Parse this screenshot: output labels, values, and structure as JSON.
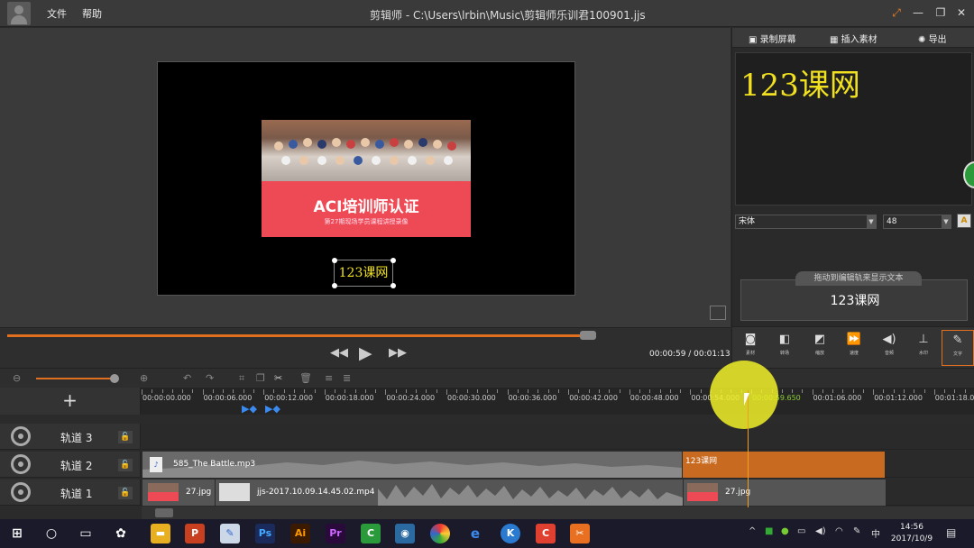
{
  "titlebar": {
    "menu": [
      "文件",
      "帮助"
    ],
    "title": "剪辑师 - C:\\Users\\lrbin\\Music\\剪辑师乐训君100901.jjs"
  },
  "preview": {
    "banner_title": "ACI培训师认证",
    "banner_sub": "第27期现场学员课程讲授录像",
    "overlay_text": "123课网"
  },
  "playback": {
    "progress": 0.99,
    "time": "00:00:59 / 00:01:13"
  },
  "right_panel": {
    "tabs": [
      "录制屏幕",
      "插入素材",
      "导出"
    ],
    "text_preview": "123课网",
    "font": "宋体",
    "size": "48",
    "color_btn": "A",
    "drag_hint": "拖动到编辑轨来显示文本",
    "drag_text": "123课网",
    "tools": [
      {
        "icon": "camera-icon",
        "label": "素材"
      },
      {
        "icon": "transition-icon",
        "label": "转场"
      },
      {
        "icon": "zoom-icon",
        "label": "缩放"
      },
      {
        "icon": "speed-icon",
        "label": "速度"
      },
      {
        "icon": "audio-icon",
        "label": "音频"
      },
      {
        "icon": "watermark-icon",
        "label": "水印"
      },
      {
        "icon": "pen-icon",
        "label": "文字"
      }
    ]
  },
  "timeline": {
    "add_label": "+",
    "ticks": [
      "00:00:00.000",
      "00:00:06.000",
      "00:00:12.000",
      "00:00:18.000",
      "00:00:24.000",
      "00:00:30.000",
      "00:00:36.000",
      "00:00:42.000",
      "00:00:48.000",
      "00:00:54.000",
      "00:00:59.650",
      "00:01:06.000",
      "00:01:12.000",
      "00:01:18.000"
    ],
    "tracks": [
      {
        "label": "轨道 3",
        "lock": "🔓"
      },
      {
        "label": "轨道 2",
        "lock": "🔓"
      },
      {
        "label": "轨道 1",
        "lock": "🔓"
      }
    ],
    "clips": {
      "audio": "585_The Battle.mp3",
      "text": "123课网",
      "img1": "27.jpg",
      "video": "jjs-2017.10.09.14.45.02.mp4",
      "img2": "27.jpg"
    }
  },
  "taskbar": {
    "icons": [
      "start-icon",
      "cortana-icon",
      "taskview-icon",
      "pinwheel-icon",
      "explorer-icon",
      "powerpoint-icon",
      "paint-icon",
      "photoshop-icon",
      "illustrator-icon",
      "premiere-icon",
      "camtasia-icon",
      "capture-icon",
      "chrome-icon",
      "edge-icon",
      "kugou-icon",
      "app-icon",
      "jianjishi-icon"
    ],
    "labels": {
      "ps": "Ps",
      "ai": "Ai",
      "pr": "Pr"
    },
    "ime": "中",
    "time": "14:56",
    "date": "2017/10/9"
  },
  "colors": {
    "accent": "#e07020",
    "text_yellow": "#f0e020",
    "banner_red": "#ee4a55"
  }
}
